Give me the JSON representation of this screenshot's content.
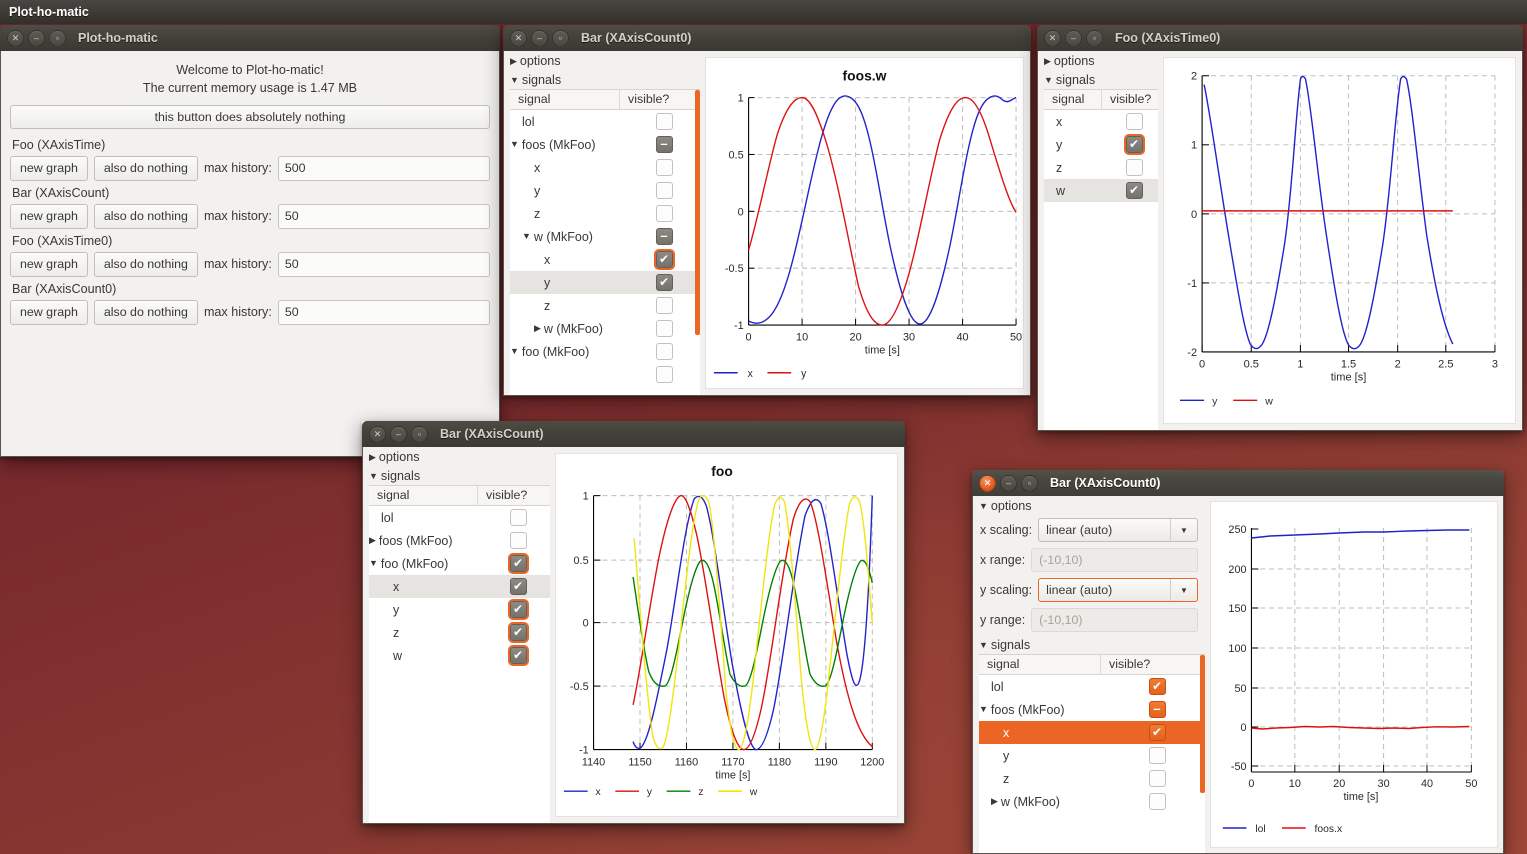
{
  "panel": {
    "title": "Plot-ho-matic"
  },
  "main_window": {
    "title": "Plot-ho-matic",
    "welcome_line1": "Welcome to Plot-ho-matic!",
    "welcome_line2": "The current memory usage is 1.47 MB",
    "nothing_button": "this button does absolutely nothing",
    "groups": [
      {
        "label": "Foo (XAxisTime)",
        "new_graph": "new graph",
        "also": "also do nothing",
        "hist_label": "max history:",
        "hist_value": "500"
      },
      {
        "label": "Bar (XAxisCount)",
        "new_graph": "new graph",
        "also": "also do nothing",
        "hist_label": "max history:",
        "hist_value": "50"
      },
      {
        "label": "Foo (XAxisTime0)",
        "new_graph": "new graph",
        "also": "also do nothing",
        "hist_label": "max history:",
        "hist_value": "50"
      },
      {
        "label": "Bar (XAxisCount0)",
        "new_graph": "new graph",
        "also": "also do nothing",
        "hist_label": "max history:",
        "hist_value": "50"
      }
    ]
  },
  "win_bar_count0_top": {
    "title": "Bar (XAxisCount0)",
    "options_label": "options",
    "signals_label": "signals",
    "col_signal": "signal",
    "col_visible": "visible?",
    "rows": [
      {
        "label": "lol",
        "indent": 1,
        "tri": "",
        "state": "off"
      },
      {
        "label": "foos (MkFoo)",
        "indent": 0,
        "tri": "▼",
        "state": "partial"
      },
      {
        "label": "x",
        "indent": 2,
        "tri": "",
        "state": "off"
      },
      {
        "label": "y",
        "indent": 2,
        "tri": "",
        "state": "off"
      },
      {
        "label": "z",
        "indent": 2,
        "tri": "",
        "state": "off"
      },
      {
        "label": "w (MkFoo)",
        "indent": 1,
        "tri": "▼",
        "state": "partial"
      },
      {
        "label": "x",
        "indent": 3,
        "tri": "",
        "state": "on",
        "focus": true
      },
      {
        "label": "y",
        "indent": 3,
        "tri": "",
        "state": "on",
        "selected": true
      },
      {
        "label": "z",
        "indent": 3,
        "tri": "",
        "state": "off"
      },
      {
        "label": "w (MkFoo)",
        "indent": 2,
        "tri": "▶",
        "state": "off"
      },
      {
        "label": "foo (MkFoo)",
        "indent": 0,
        "tri": "▼",
        "state": "off"
      },
      {
        "label": "",
        "indent": 2,
        "tri": "",
        "state": "off"
      }
    ]
  },
  "win_foo_time0": {
    "title": "Foo (XAxisTime0)",
    "options_label": "options",
    "signals_label": "signals",
    "col_signal": "signal",
    "col_visible": "visible?",
    "rows": [
      {
        "label": "x",
        "indent": 1,
        "tri": "",
        "state": "off"
      },
      {
        "label": "y",
        "indent": 1,
        "tri": "",
        "state": "on",
        "focus": true
      },
      {
        "label": "z",
        "indent": 1,
        "tri": "",
        "state": "off"
      },
      {
        "label": "w",
        "indent": 1,
        "tri": "",
        "state": "on",
        "selected": true
      }
    ]
  },
  "win_bar_count": {
    "title": "Bar (XAxisCount)",
    "options_label": "options",
    "signals_label": "signals",
    "col_signal": "signal",
    "col_visible": "visible?",
    "rows": [
      {
        "label": "lol",
        "indent": 1,
        "tri": "",
        "state": "off"
      },
      {
        "label": "foos (MkFoo)",
        "indent": 0,
        "tri": "▶",
        "state": "off"
      },
      {
        "label": "foo (MkFoo)",
        "indent": 0,
        "tri": "▼",
        "state": "on",
        "focus": true
      },
      {
        "label": "x",
        "indent": 2,
        "tri": "",
        "state": "on",
        "selected": true
      },
      {
        "label": "y",
        "indent": 2,
        "tri": "",
        "state": "on",
        "focus": true
      },
      {
        "label": "z",
        "indent": 2,
        "tri": "",
        "state": "on",
        "focus": true
      },
      {
        "label": "w",
        "indent": 2,
        "tri": "",
        "state": "on",
        "focus": true
      }
    ]
  },
  "win_bar_count0_bottom": {
    "title": "Bar (XAxisCount0)",
    "options_label": "options",
    "signals_label": "signals",
    "col_signal": "signal",
    "col_visible": "visible?",
    "x_scaling_label": "x scaling:",
    "x_scaling_value": "linear (auto)",
    "x_range_label": "x range:",
    "x_range_placeholder": "(-10,10)",
    "y_scaling_label": "y scaling:",
    "y_scaling_value": "linear (auto)",
    "y_range_label": "y range:",
    "y_range_placeholder": "(-10,10)",
    "rows": [
      {
        "label": "lol",
        "indent": 1,
        "tri": "",
        "state": "on-orange"
      },
      {
        "label": "foos (MkFoo)",
        "indent": 0,
        "tri": "▼",
        "state": "partial-orange"
      },
      {
        "label": "x",
        "indent": 2,
        "tri": "",
        "state": "on-orange",
        "row_orange": true
      },
      {
        "label": "y",
        "indent": 2,
        "tri": "",
        "state": "off"
      },
      {
        "label": "z",
        "indent": 2,
        "tri": "",
        "state": "off"
      },
      {
        "label": "w (MkFoo)",
        "indent": 1,
        "tri": "▶",
        "state": "off"
      }
    ]
  },
  "colors": {
    "series_x": "#2222cc",
    "series_y": "#dd1111",
    "series_z": "#008000",
    "series_w": "#f2e50b",
    "accent": "#eb6625",
    "desktop": "#8b3a32"
  },
  "chart_data": [
    {
      "id": "chart_foos_w",
      "type": "line",
      "title": "foos.w",
      "xlabel": "time [s]",
      "ylabel": "",
      "xlim": [
        0,
        50
      ],
      "ylim": [
        -1,
        1
      ],
      "xticks": [
        0,
        10,
        20,
        30,
        40,
        50
      ],
      "yticks": [
        -1,
        -0.5,
        0,
        0.5,
        1
      ],
      "grid": true,
      "legend": [
        "x",
        "y"
      ],
      "legend_position": "bottom-left",
      "series": [
        {
          "name": "x",
          "color": "#2222cc",
          "formula": "sin(2*pi*(t-17.7)/31.5)",
          "amplitude": 1,
          "period": 31.5,
          "phase_peak_t": 17.7
        },
        {
          "name": "y",
          "color": "#dd1111",
          "formula": "sin(2*pi*(t-9.8)/31.5)",
          "amplitude": 1,
          "period": 31.5,
          "phase_peak_t": 9.8
        }
      ]
    },
    {
      "id": "chart_foo_time0",
      "type": "line",
      "title": "",
      "xlabel": "time [s]",
      "ylabel": "",
      "xlim": [
        0,
        3
      ],
      "ylim": [
        -2,
        2
      ],
      "xticks": [
        0,
        0.5,
        1,
        1.5,
        2,
        2.5,
        3
      ],
      "yticks": [
        -2,
        -1,
        0,
        1,
        2
      ],
      "grid": true,
      "legend": [
        "y",
        "w"
      ],
      "legend_position": "bottom-left",
      "data_xmax": 2.55,
      "series": [
        {
          "name": "y",
          "color": "#2222cc",
          "formula": "2*sin(2*pi*(t-0.99)/1.06)",
          "amplitude": 2,
          "period": 1.06,
          "phase_peak_t": 0.99
        },
        {
          "name": "w",
          "color": "#dd1111",
          "formula": "constant 0.1",
          "constant": 0.1
        }
      ]
    },
    {
      "id": "chart_foo",
      "type": "line",
      "title": "foo",
      "xlabel": "time [s]",
      "ylabel": "",
      "xlim": [
        1140,
        1200
      ],
      "ylim": [
        -1,
        1
      ],
      "xticks": [
        1140,
        1150,
        1160,
        1170,
        1180,
        1190,
        1200
      ],
      "yticks": [
        -1,
        -0.5,
        0,
        0.5,
        1
      ],
      "grid": true,
      "legend": [
        "x",
        "y",
        "z",
        "w"
      ],
      "legend_position": "bottom-left",
      "data_xmin": 1148.5,
      "data_xmax": 1198,
      "series": [
        {
          "name": "x",
          "color": "#2222cc",
          "amplitude": 1,
          "period": 31.5,
          "phase_peak_t": 1166.2
        },
        {
          "name": "y",
          "color": "#dd1111",
          "amplitude": 1,
          "period": 31.5,
          "phase_peak_t": 1158.5
        },
        {
          "name": "z",
          "color": "#008000",
          "amplitude": 0.5,
          "period": 15.7,
          "phase_peak_t": 1162.6
        },
        {
          "name": "w",
          "color": "#f2e50b",
          "amplitude": 1,
          "period": 15.7,
          "phase_peak_t": 1162.4
        }
      ]
    },
    {
      "id": "chart_lol_foosx",
      "type": "line",
      "title": "",
      "xlabel": "time [s]",
      "ylabel": "",
      "xlim": [
        0,
        50
      ],
      "ylim": [
        -50,
        250
      ],
      "xticks": [
        0,
        10,
        20,
        30,
        40,
        50
      ],
      "yticks": [
        -50,
        0,
        50,
        100,
        150,
        200,
        250
      ],
      "grid": true,
      "legend": [
        "lol",
        "foos.x"
      ],
      "legend_position": "bottom-left",
      "series": [
        {
          "name": "lol",
          "color": "#2222cc",
          "values_start": 237,
          "values_end": 247,
          "trend": "slowly increasing"
        },
        {
          "name": "foos.x",
          "color": "#dd1111",
          "values_start": 0,
          "values_end": 1,
          "trend": "flat near zero, small noise"
        }
      ]
    }
  ]
}
